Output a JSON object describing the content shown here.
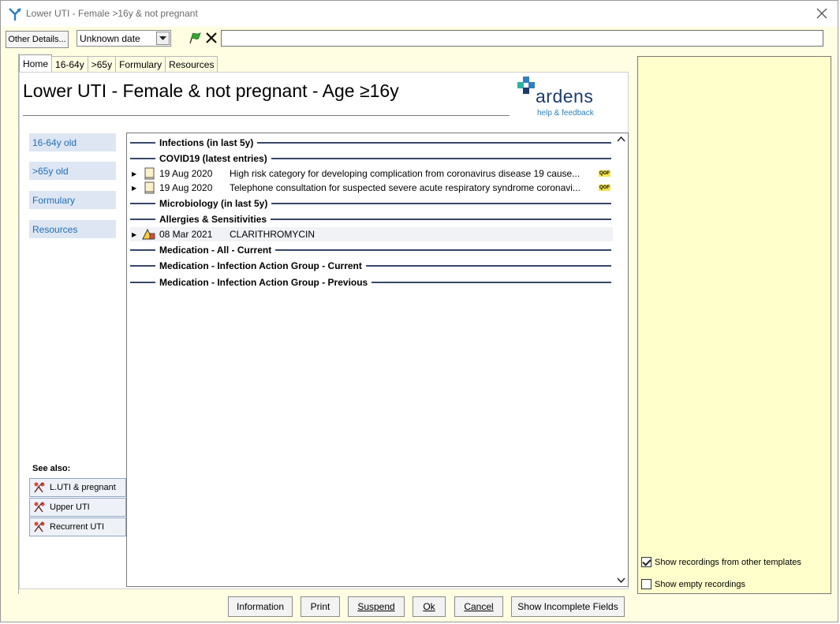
{
  "window": {
    "title": "Lower UTI - Female >16y & not pregnant"
  },
  "toolbar": {
    "other_details_label": "Other Details...",
    "date_value": "Unknown date",
    "freetext_value": ""
  },
  "tabs": [
    "Home",
    "16-64y",
    ">65y",
    "Formulary",
    "Resources"
  ],
  "page": {
    "title_prefix": "Lower UTI - Female & not pregnant - Age ",
    "title_ge": "≥",
    "title_age": "16y",
    "logo_word": "ardens",
    "logo_sub": "help & feedback"
  },
  "nav": [
    "16-64y old",
    ">65y old",
    "Formulary",
    "Resources"
  ],
  "see_also": {
    "heading": "See also:",
    "items": [
      "L.UTI & pregnant",
      "Upper UTI",
      "Recurrent UTI"
    ]
  },
  "records": {
    "sections": [
      "Infections (in last 5y)",
      "COVID19 (latest entries)",
      "Microbiology (in last 5y)",
      "Allergies & Sensitivities",
      "Medication - All - Current",
      "Medication - Infection Action Group - Current",
      "Medication - Infection Action Group - Previous"
    ],
    "covid_rows": [
      {
        "date": "19 Aug 2020",
        "term": "High risk category for developing complication from coronavirus disease 19 cause...",
        "badge": "QOF"
      },
      {
        "date": "19 Aug 2020",
        "term": "Telephone consultation for suspected severe acute respiratory syndrome coronavi...",
        "badge": "QOF"
      }
    ],
    "allergy_rows": [
      {
        "date": "08 Mar 2021",
        "term": "CLARITHROMYCIN"
      }
    ]
  },
  "right_panel": {
    "show_other_templates": "Show recordings from other templates",
    "show_other_templates_checked": true,
    "show_empty": "Show empty recordings",
    "show_empty_checked": false
  },
  "buttons": {
    "information": "Information",
    "print": "Print",
    "suspend": "Suspend",
    "ok": "Ok",
    "cancel": "Cancel",
    "show_incomplete": "Show Incomplete Fields"
  }
}
